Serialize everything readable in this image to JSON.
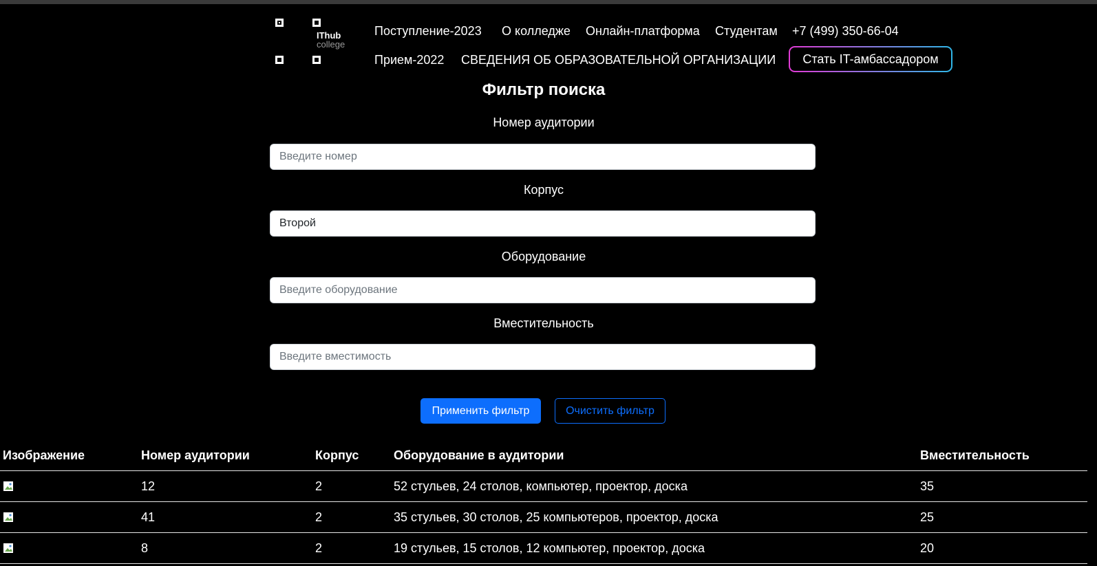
{
  "header": {
    "logo": {
      "brand_line1": "IThub",
      "brand_line2": "college"
    },
    "nav_row1": [
      "Поступление-2023",
      "О колледже",
      "Онлайн-платформа",
      "Студентам",
      "+7 (499) 350-66-04"
    ],
    "nav_row2": [
      "Прием-2022",
      "СВЕДЕНИЯ ОБ ОБРАЗОВАТЕЛЬНОЙ ОРГАНИЗАЦИИ"
    ],
    "ambassador_button": "Стать IT-амбассадором"
  },
  "filter": {
    "title": "Фильтр поиска",
    "room_number": {
      "label": "Номер аудитории",
      "value": "",
      "placeholder": "Введите номер"
    },
    "building": {
      "label": "Корпус",
      "value": "Второй",
      "placeholder": ""
    },
    "equipment": {
      "label": "Оборудование",
      "value": "",
      "placeholder": "Введите оборудование"
    },
    "capacity": {
      "label": "Вместительность",
      "value": "",
      "placeholder": "Введите вместимость"
    },
    "apply_button": "Применить фильтр",
    "clear_button": "Очистить фильтр"
  },
  "table": {
    "headers": [
      "Изображение",
      "Номер аудитории",
      "Корпус",
      "Оборудование в аудитории",
      "Вместительность"
    ],
    "rows": [
      {
        "room": "12",
        "building": "2",
        "equipment": "52 стульев, 24 столов, компьютер, проектор, доска",
        "capacity": "35"
      },
      {
        "room": "41",
        "building": "2",
        "equipment": "35 стульев, 30 столов, 25 компьютеров, проектор, доска",
        "capacity": "25"
      },
      {
        "room": "8",
        "building": "2",
        "equipment": "19 стульев, 15 столов, 12 компьютер, проектор, доска",
        "capacity": "20"
      }
    ]
  },
  "colors": {
    "primary": "#0d6efd",
    "gradient_start": "#e23ad6",
    "gradient_end": "#2fb7e8"
  }
}
